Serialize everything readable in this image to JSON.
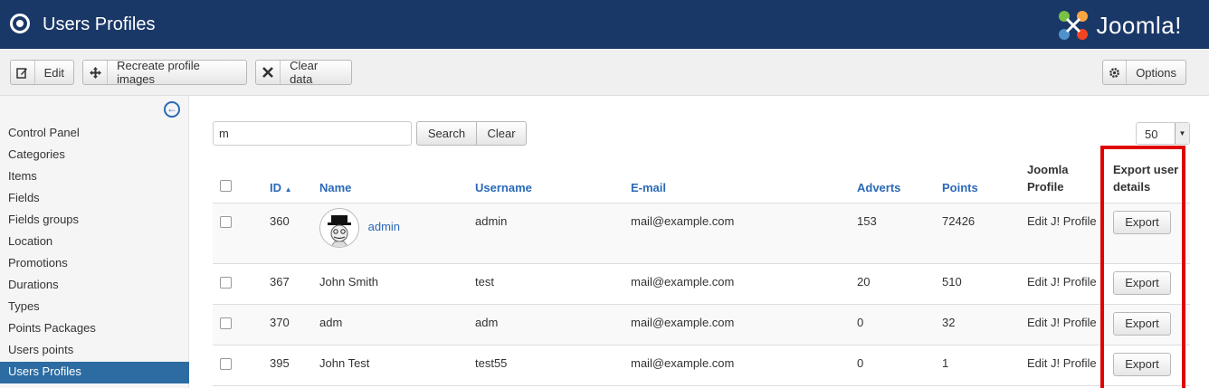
{
  "header": {
    "title": "Users Profiles",
    "brand": "Joomla!"
  },
  "toolbar": {
    "edit": "Edit",
    "recreate": "Recreate profile images",
    "clear_data": "Clear data",
    "options": "Options"
  },
  "sidebar": {
    "items": [
      "Control Panel",
      "Categories",
      "Items",
      "Fields",
      "Fields groups",
      "Location",
      "Promotions",
      "Durations",
      "Types",
      "Points Packages",
      "Users points",
      "Users Profiles"
    ],
    "active": "Users Profiles"
  },
  "filter": {
    "search_value": "m",
    "search_button": "Search",
    "clear_button": "Clear",
    "limit": "50"
  },
  "table": {
    "headers": {
      "id": "ID",
      "name": "Name",
      "username": "Username",
      "email": "E-mail",
      "adverts": "Adverts",
      "points": "Points",
      "joomla_profile": "Joomla Profile",
      "export": "Export user details"
    },
    "sort_indicator": "▲",
    "rows": [
      {
        "id": "360",
        "name": "admin",
        "username": "admin",
        "email": "mail@example.com",
        "adverts": "153",
        "points": "72426",
        "profile_link": "Edit J! Profile",
        "export": "Export"
      },
      {
        "id": "367",
        "name": "John Smith",
        "username": "test",
        "email": "mail@example.com",
        "adverts": "20",
        "points": "510",
        "profile_link": "Edit J! Profile",
        "export": "Export"
      },
      {
        "id": "370",
        "name": "adm",
        "username": "adm",
        "email": "mail@example.com",
        "adverts": "0",
        "points": "32",
        "profile_link": "Edit J! Profile",
        "export": "Export"
      },
      {
        "id": "395",
        "name": "John Test",
        "username": "test55",
        "email": "mail@example.com",
        "adverts": "0",
        "points": "1",
        "profile_link": "Edit J! Profile",
        "export": "Export"
      }
    ]
  },
  "colors": {
    "header_bg": "#1a3867",
    "link": "#2a69b8",
    "active_nav": "#2d6ca2",
    "highlight": "#e00000"
  }
}
